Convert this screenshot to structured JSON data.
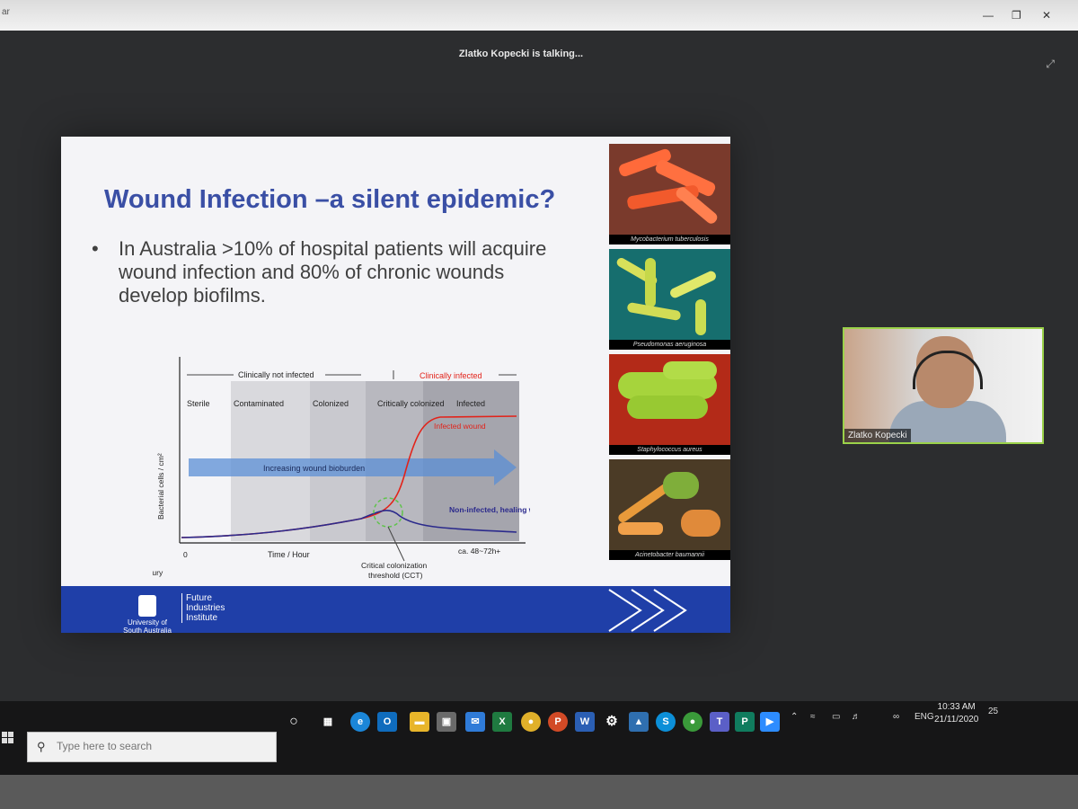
{
  "window": {
    "title_fragment": "ar",
    "talking_text": "Zlatko Kopecki is talking..."
  },
  "slide": {
    "title": "Wound Infection –a silent epidemic?",
    "bullet_marker": "•",
    "bullet_text": "In Australia >10% of hospital patients will acquire wound infection and 80% of chronic wounds develop biofilms.",
    "photos": [
      {
        "caption": "Mycobacterium tuberculosis"
      },
      {
        "caption": "Pseudomonas aeruginosa"
      },
      {
        "caption": "Staphylococcus aureus"
      },
      {
        "caption": "Acinetobacter baumannii"
      }
    ],
    "footer": {
      "university_line1": "University of",
      "university_line2": "South Australia",
      "institute_line1": "Future",
      "institute_line2": "Industries",
      "institute_line3": "Institute"
    }
  },
  "chart_data": {
    "type": "line",
    "header_left": "Clinically not infected",
    "header_right": "Clinically infected",
    "stages": [
      "Sterile",
      "Contaminated",
      "Colonized",
      "Critically colonized",
      "Infected"
    ],
    "arrow_label": "Increasing wound bioburden",
    "ylabel": "Bacterial cells / cm²",
    "xlabel": "Time / Hour",
    "x_origin_label": "0",
    "x_end_label": "ca. 48~72h+",
    "start_label": "Skin injury",
    "threshold_label_line1": "Critical colonization",
    "threshold_label_line2": "threshold (CCT)",
    "series": [
      {
        "name": "Infected wound",
        "color": "#e2231a"
      },
      {
        "name": "Non-infected, healing wound",
        "color": "#2b2a8c"
      }
    ]
  },
  "participant": {
    "name": "Zlatko Kopecki"
  },
  "taskbar": {
    "search_placeholder": "Type here to search",
    "language": "ENG",
    "time": "10:33 AM",
    "date": "21/11/2020",
    "notification_count": "25"
  },
  "colors": {
    "slide_title": "#3a4fa5",
    "footer_blue": "#1f3fa8",
    "video_border": "#9bd24a"
  }
}
